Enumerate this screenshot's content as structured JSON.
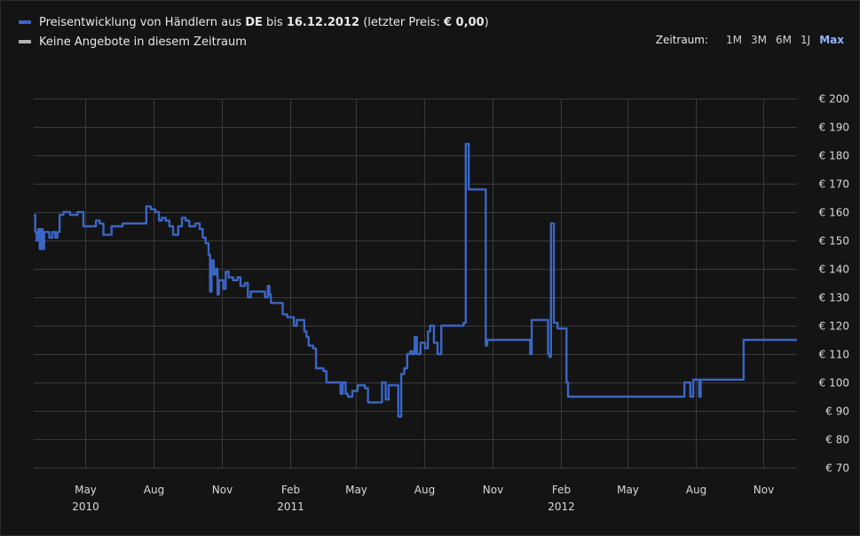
{
  "legend": {
    "series_prefix": "Preisentwicklung von Händlern aus ",
    "series_country": "DE",
    "series_mid": " bis ",
    "series_date": "16.12.2012",
    "series_after": " (letzter Preis: ",
    "series_price": "€ 0,00",
    "series_close": ")",
    "series_color": "#3b66c4",
    "no_offers": "Keine Angebote in diesem Zeitraum",
    "no_offers_color": "#b4b4b4"
  },
  "range": {
    "label": "Zeitraum:",
    "options": [
      "1M",
      "3M",
      "6M",
      "1J",
      "Max"
    ],
    "active": "Max"
  },
  "chart_data": {
    "type": "line",
    "ylim": [
      70,
      200
    ],
    "yticks": [
      "€ 200",
      "€ 190",
      "€ 180",
      "€ 170",
      "€ 160",
      "€ 150",
      "€ 140",
      "€ 130",
      "€ 120",
      "€ 110",
      "€ 100",
      "€ 90",
      "€ 80",
      "€ 70"
    ],
    "yvalues": [
      200,
      190,
      180,
      170,
      160,
      150,
      140,
      130,
      120,
      110,
      100,
      90,
      80,
      70
    ],
    "xlim": [
      "2010-02-20",
      "2012-12-16"
    ],
    "xticks": [
      {
        "date": "2010-05-01",
        "label": "May",
        "year": "2010"
      },
      {
        "date": "2010-08-01",
        "label": "Aug",
        "year": ""
      },
      {
        "date": "2010-11-01",
        "label": "Nov",
        "year": ""
      },
      {
        "date": "2011-02-01",
        "label": "Feb",
        "year": "2011"
      },
      {
        "date": "2011-05-01",
        "label": "May",
        "year": ""
      },
      {
        "date": "2011-08-01",
        "label": "Aug",
        "year": ""
      },
      {
        "date": "2011-11-01",
        "label": "Nov",
        "year": ""
      },
      {
        "date": "2012-02-01",
        "label": "Feb",
        "year": "2012"
      },
      {
        "date": "2012-05-01",
        "label": "May",
        "year": ""
      },
      {
        "date": "2012-08-01",
        "label": "Aug",
        "year": ""
      },
      {
        "date": "2012-11-01",
        "label": "Nov",
        "year": ""
      }
    ],
    "series": [
      {
        "color": "#3b66c4",
        "points": [
          [
            "2010-02-20",
            159
          ],
          [
            "2010-02-22",
            153
          ],
          [
            "2010-02-24",
            150
          ],
          [
            "2010-02-26",
            154
          ],
          [
            "2010-02-28",
            147
          ],
          [
            "2010-03-02",
            154
          ],
          [
            "2010-03-04",
            147
          ],
          [
            "2010-03-06",
            153
          ],
          [
            "2010-03-10",
            153
          ],
          [
            "2010-03-13",
            151
          ],
          [
            "2010-03-17",
            153
          ],
          [
            "2010-03-21",
            151
          ],
          [
            "2010-03-24",
            153
          ],
          [
            "2010-03-27",
            159
          ],
          [
            "2010-04-01",
            160
          ],
          [
            "2010-04-10",
            159
          ],
          [
            "2010-04-20",
            160
          ],
          [
            "2010-04-28",
            155
          ],
          [
            "2010-05-10",
            155
          ],
          [
            "2010-05-15",
            157
          ],
          [
            "2010-05-20",
            156
          ],
          [
            "2010-05-25",
            152
          ],
          [
            "2010-06-05",
            155
          ],
          [
            "2010-06-20",
            156
          ],
          [
            "2010-07-20",
            156
          ],
          [
            "2010-07-22",
            162
          ],
          [
            "2010-07-28",
            161
          ],
          [
            "2010-08-03",
            160
          ],
          [
            "2010-08-08",
            157
          ],
          [
            "2010-08-12",
            158
          ],
          [
            "2010-08-17",
            157
          ],
          [
            "2010-08-22",
            155
          ],
          [
            "2010-08-27",
            152
          ],
          [
            "2010-09-03",
            155
          ],
          [
            "2010-09-08",
            158
          ],
          [
            "2010-09-13",
            157
          ],
          [
            "2010-09-18",
            155
          ],
          [
            "2010-09-26",
            156
          ],
          [
            "2010-10-02",
            154
          ],
          [
            "2010-10-06",
            151
          ],
          [
            "2010-10-10",
            149
          ],
          [
            "2010-10-14",
            145
          ],
          [
            "2010-10-16",
            132
          ],
          [
            "2010-10-18",
            143
          ],
          [
            "2010-10-21",
            138
          ],
          [
            "2010-10-24",
            140
          ],
          [
            "2010-10-26",
            131
          ],
          [
            "2010-10-28",
            136
          ],
          [
            "2010-10-31",
            136
          ],
          [
            "2010-11-03",
            133
          ],
          [
            "2010-11-06",
            139
          ],
          [
            "2010-11-10",
            137
          ],
          [
            "2010-11-16",
            136
          ],
          [
            "2010-11-22",
            137
          ],
          [
            "2010-11-26",
            134
          ],
          [
            "2010-12-02",
            135
          ],
          [
            "2010-12-06",
            130
          ],
          [
            "2010-12-10",
            132
          ],
          [
            "2010-12-26",
            132
          ],
          [
            "2010-12-29",
            130
          ],
          [
            "2011-01-02",
            134
          ],
          [
            "2011-01-04",
            131
          ],
          [
            "2011-01-06",
            128
          ],
          [
            "2011-01-18",
            128
          ],
          [
            "2011-01-22",
            124
          ],
          [
            "2011-01-28",
            123
          ],
          [
            "2011-02-04",
            123
          ],
          [
            "2011-02-06",
            120
          ],
          [
            "2011-02-10",
            122
          ],
          [
            "2011-02-16",
            122
          ],
          [
            "2011-02-20",
            118
          ],
          [
            "2011-02-23",
            116
          ],
          [
            "2011-02-26",
            113
          ],
          [
            "2011-03-04",
            112
          ],
          [
            "2011-03-08",
            105
          ],
          [
            "2011-03-18",
            104
          ],
          [
            "2011-03-22",
            100
          ],
          [
            "2011-04-08",
            100
          ],
          [
            "2011-04-10",
            96
          ],
          [
            "2011-04-13",
            100
          ],
          [
            "2011-04-17",
            96
          ],
          [
            "2011-04-20",
            95
          ],
          [
            "2011-04-26",
            97
          ],
          [
            "2011-05-03",
            99
          ],
          [
            "2011-05-13",
            98
          ],
          [
            "2011-05-17",
            93
          ],
          [
            "2011-06-01",
            93
          ],
          [
            "2011-06-05",
            100
          ],
          [
            "2011-06-10",
            94
          ],
          [
            "2011-06-14",
            99
          ],
          [
            "2011-06-24",
            99
          ],
          [
            "2011-06-27",
            88
          ],
          [
            "2011-07-01",
            103
          ],
          [
            "2011-07-05",
            105
          ],
          [
            "2011-07-09",
            110
          ],
          [
            "2011-07-13",
            111
          ],
          [
            "2011-07-16",
            110
          ],
          [
            "2011-07-19",
            116
          ],
          [
            "2011-07-22",
            110
          ],
          [
            "2011-07-27",
            114
          ],
          [
            "2011-08-02",
            112
          ],
          [
            "2011-08-06",
            118
          ],
          [
            "2011-08-09",
            120
          ],
          [
            "2011-08-14",
            114
          ],
          [
            "2011-08-19",
            110
          ],
          [
            "2011-08-24",
            120
          ],
          [
            "2011-09-21",
            120
          ],
          [
            "2011-09-23",
            121
          ],
          [
            "2011-09-26",
            184
          ],
          [
            "2011-09-30",
            168
          ],
          [
            "2011-10-21",
            168
          ],
          [
            "2011-10-23",
            113
          ],
          [
            "2011-10-25",
            115
          ],
          [
            "2011-12-20",
            115
          ],
          [
            "2011-12-22",
            110
          ],
          [
            "2011-12-24",
            122
          ],
          [
            "2012-01-12",
            122
          ],
          [
            "2012-01-15",
            110
          ],
          [
            "2012-01-17",
            109
          ],
          [
            "2012-01-19",
            156
          ],
          [
            "2012-01-23",
            121
          ],
          [
            "2012-01-28",
            119
          ],
          [
            "2012-02-06",
            119
          ],
          [
            "2012-02-09",
            100
          ],
          [
            "2012-02-11",
            95
          ],
          [
            "2012-07-15",
            95
          ],
          [
            "2012-07-17",
            100
          ],
          [
            "2012-07-23",
            100
          ],
          [
            "2012-07-25",
            95
          ],
          [
            "2012-07-29",
            101
          ],
          [
            "2012-08-04",
            101
          ],
          [
            "2012-08-06",
            95
          ],
          [
            "2012-08-08",
            101
          ],
          [
            "2012-10-03",
            101
          ],
          [
            "2012-10-05",
            115
          ],
          [
            "2012-12-16",
            115
          ]
        ]
      }
    ]
  }
}
